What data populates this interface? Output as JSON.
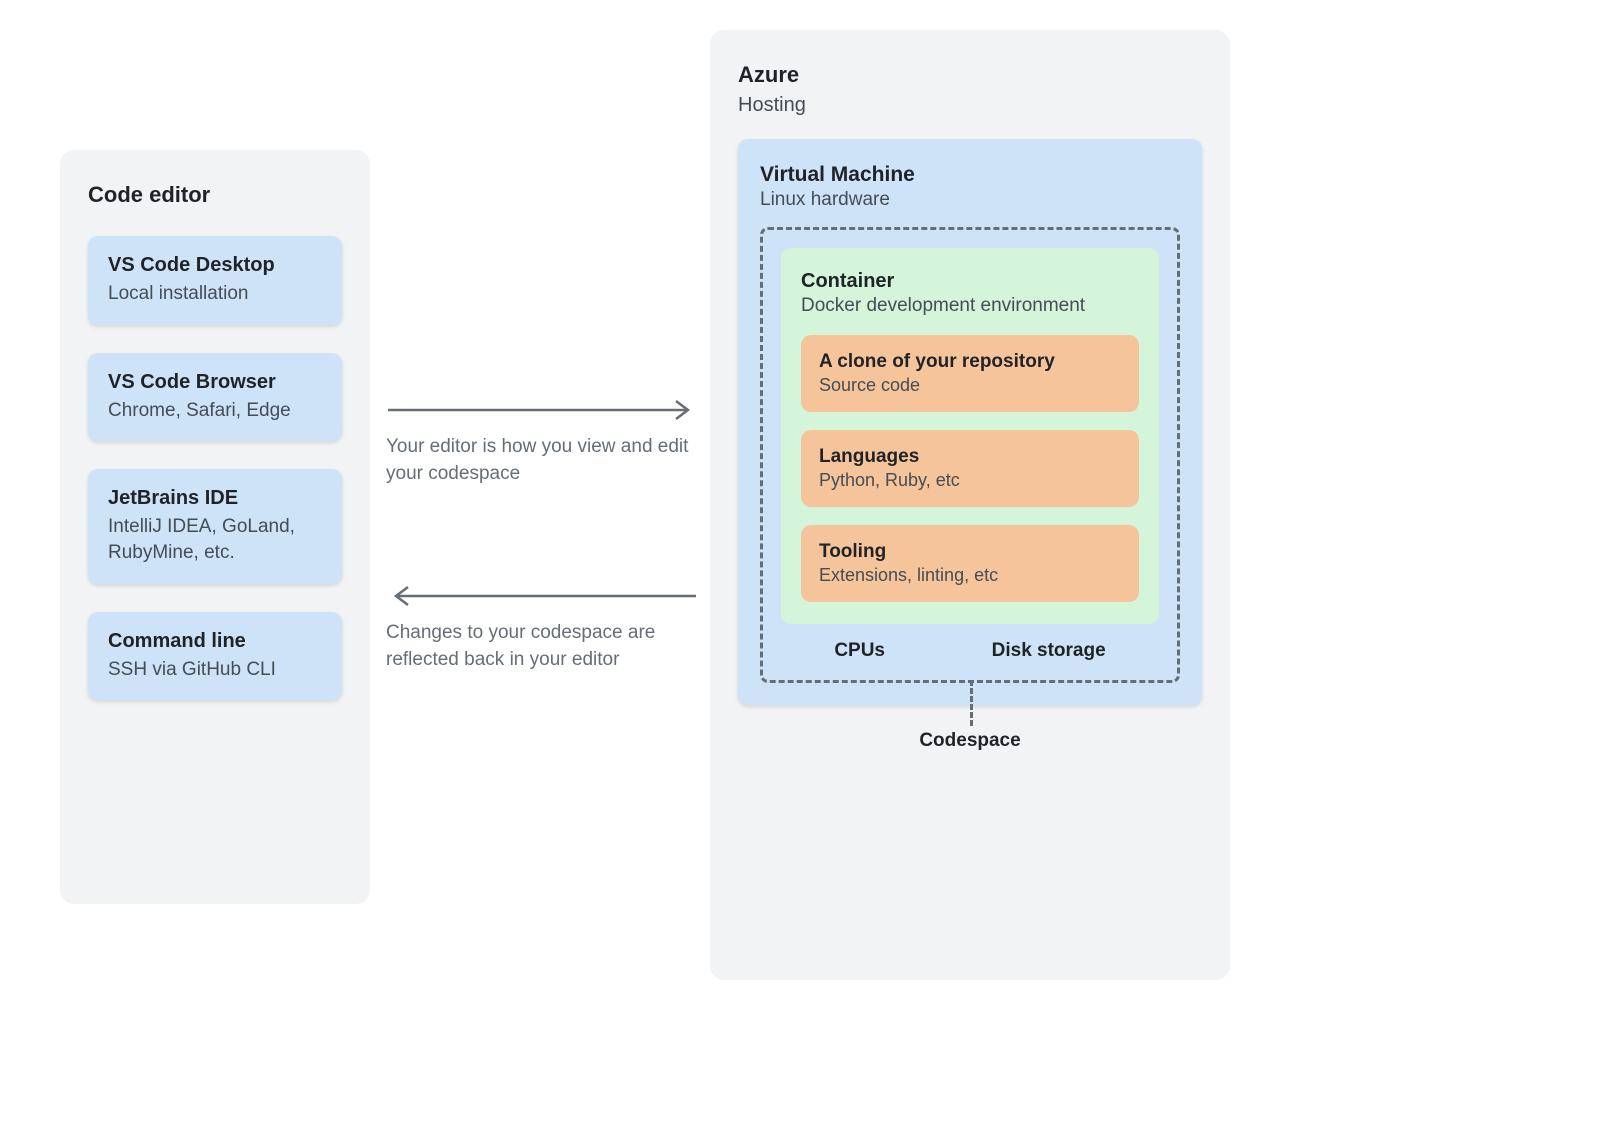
{
  "editor": {
    "title": "Code editor",
    "items": [
      {
        "title": "VS Code Desktop",
        "sub": "Local installation"
      },
      {
        "title": "VS Code Browser",
        "sub": "Chrome, Safari, Edge"
      },
      {
        "title": "JetBrains IDE",
        "sub": "IntelliJ IDEA, GoLand, RubyMine, etc."
      },
      {
        "title": "Command line",
        "sub": "SSH via GitHub CLI"
      }
    ]
  },
  "arrows": {
    "forward": "Your editor is how you view and edit your codespace",
    "back": "Changes to your codespace are reflected back in your editor"
  },
  "azure": {
    "title": "Azure",
    "sub": "Hosting",
    "vm": {
      "title": "Virtual Machine",
      "sub": "Linux hardware",
      "container": {
        "title": "Container",
        "sub": "Docker development environment",
        "items": [
          {
            "title": "A clone of your repository",
            "sub": "Source code"
          },
          {
            "title": "Languages",
            "sub": "Python, Ruby, etc"
          },
          {
            "title": "Tooling",
            "sub": "Extensions, linting, etc"
          }
        ]
      },
      "hw": {
        "cpus": "CPUs",
        "disk": "Disk storage"
      },
      "codespace_label": "Codespace"
    }
  }
}
